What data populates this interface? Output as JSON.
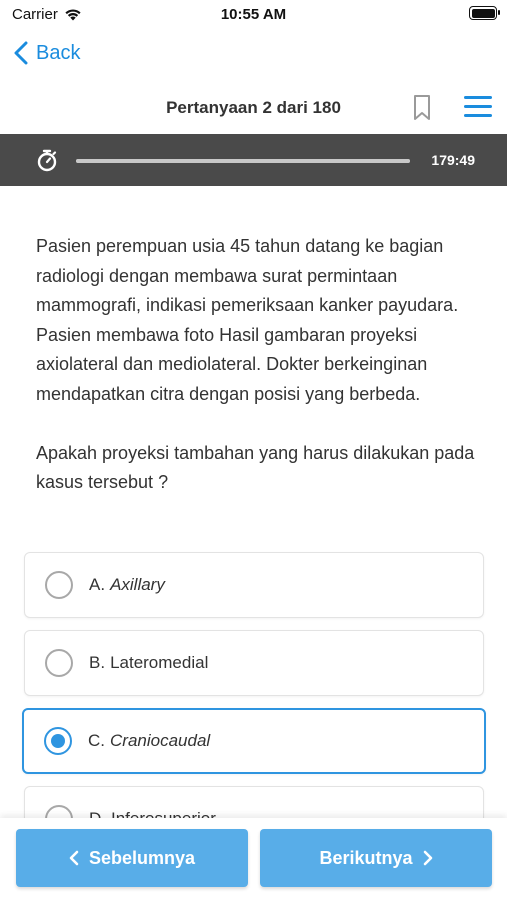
{
  "status": {
    "carrier": "Carrier",
    "time": "10:55 AM"
  },
  "nav": {
    "back_label": "Back"
  },
  "header": {
    "title": "Pertanyaan 2 dari 180"
  },
  "timer": {
    "remaining": "179:49"
  },
  "question": {
    "paragraph_1": "Pasien perempuan usia 45 tahun datang ke bagian radiologi dengan membawa surat permintaan mammografi, indikasi pemeriksaan kanker payudara. Pasien membawa foto Hasil gambaran proyeksi axiolateral dan mediolateral. Dokter berkeinginan mendapatkan citra dengan posisi yang berbeda.",
    "paragraph_2": "Apakah proyeksi tambahan yang harus dilakukan pada kasus tersebut ?"
  },
  "options": [
    {
      "letter": "A.",
      "text": "Axillary",
      "selected": false
    },
    {
      "letter": "B.",
      "text": "Lateromedial",
      "selected": false
    },
    {
      "letter": "C.",
      "text": "Craniocaudal",
      "selected": true
    },
    {
      "letter": "D.",
      "text": "Inferosuperior",
      "selected": false
    }
  ],
  "footer": {
    "prev_label": "Sebelumnya",
    "next_label": "Berikutnya"
  },
  "colors": {
    "accent": "#1a8cde",
    "button": "#58ade8",
    "timer_bar": "#4a4a4a"
  },
  "icons": [
    "wifi-icon",
    "battery-icon",
    "back-chevron-icon",
    "bookmark-icon",
    "menu-icon",
    "stopwatch-icon",
    "chevron-left-icon",
    "chevron-right-icon"
  ]
}
